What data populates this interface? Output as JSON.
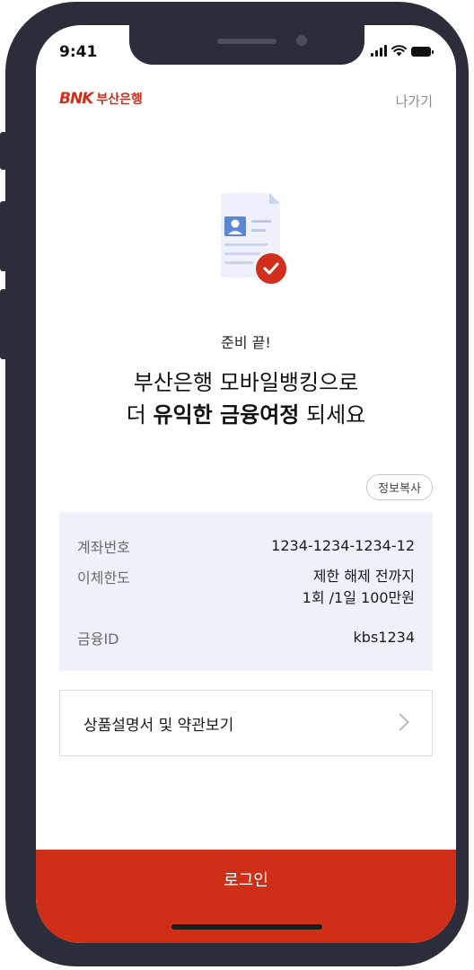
{
  "status_bar": {
    "time": "9:41"
  },
  "header": {
    "logo_mark": "BNK",
    "logo_text": "부산은행",
    "exit_label": "나가기"
  },
  "illustration": {
    "icon": "document-check-icon",
    "accent_color": "#d12e1c"
  },
  "content": {
    "sub_title": "준비 끝!",
    "title_line1": "부산은행 모바일뱅킹으로",
    "title_line2_prefix": "더 ",
    "title_line2_bold": "유익한 금융여정",
    "title_line2_suffix": " 되세요"
  },
  "copy_button": {
    "label": "정보복사"
  },
  "info": {
    "account_label": "계좌번호",
    "account_value": "1234-1234-1234-12",
    "limit_label": "이체한도",
    "limit_value_line1": "제한 해제 전까지",
    "limit_value_line2": "1회 /1일 100만원",
    "id_label": "금융ID",
    "id_value": "kbs1234"
  },
  "terms": {
    "label": "상품설명서 및 약관보기",
    "icon": "chevron-right-icon"
  },
  "footer": {
    "login_label": "로그인",
    "button_color": "#cf2f17"
  }
}
